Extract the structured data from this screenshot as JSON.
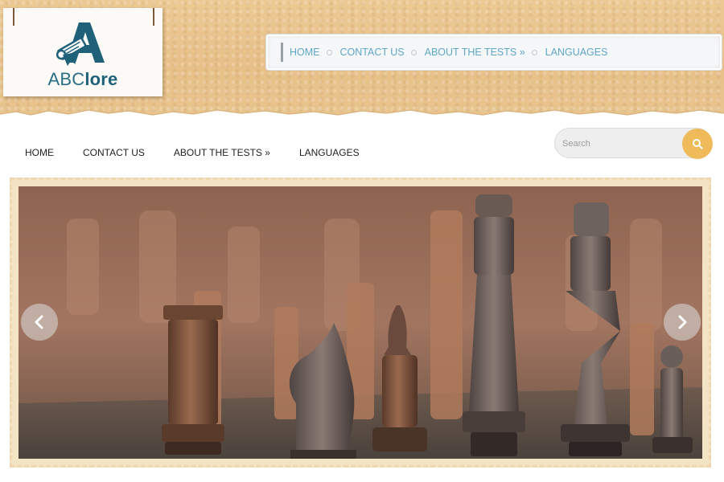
{
  "brand": {
    "name_light": "ABC",
    "name_bold": "lore"
  },
  "top_menu": {
    "items": [
      {
        "label": "HOME"
      },
      {
        "label": "CONTACT US"
      },
      {
        "label": "ABOUT THE TESTS »"
      },
      {
        "label": "LANGUAGES"
      }
    ]
  },
  "main_nav": {
    "items": [
      {
        "label": "HOME"
      },
      {
        "label": "CONTACT US"
      },
      {
        "label": "ABOUT THE TESTS »"
      },
      {
        "label": "LANGUAGES"
      }
    ]
  },
  "search": {
    "placeholder": "Search",
    "button_icon": "search-icon"
  },
  "slider": {
    "image_subject": "wooden chess pieces",
    "prev_icon": "chevron-left-icon",
    "next_icon": "chevron-right-icon"
  },
  "colors": {
    "parchment": "#e9c58f",
    "link_blue": "#5fa6c8",
    "brand_teal": "#2a6f86",
    "search_button": "#eeba5a",
    "slider_frame": "#f4e4c6"
  }
}
